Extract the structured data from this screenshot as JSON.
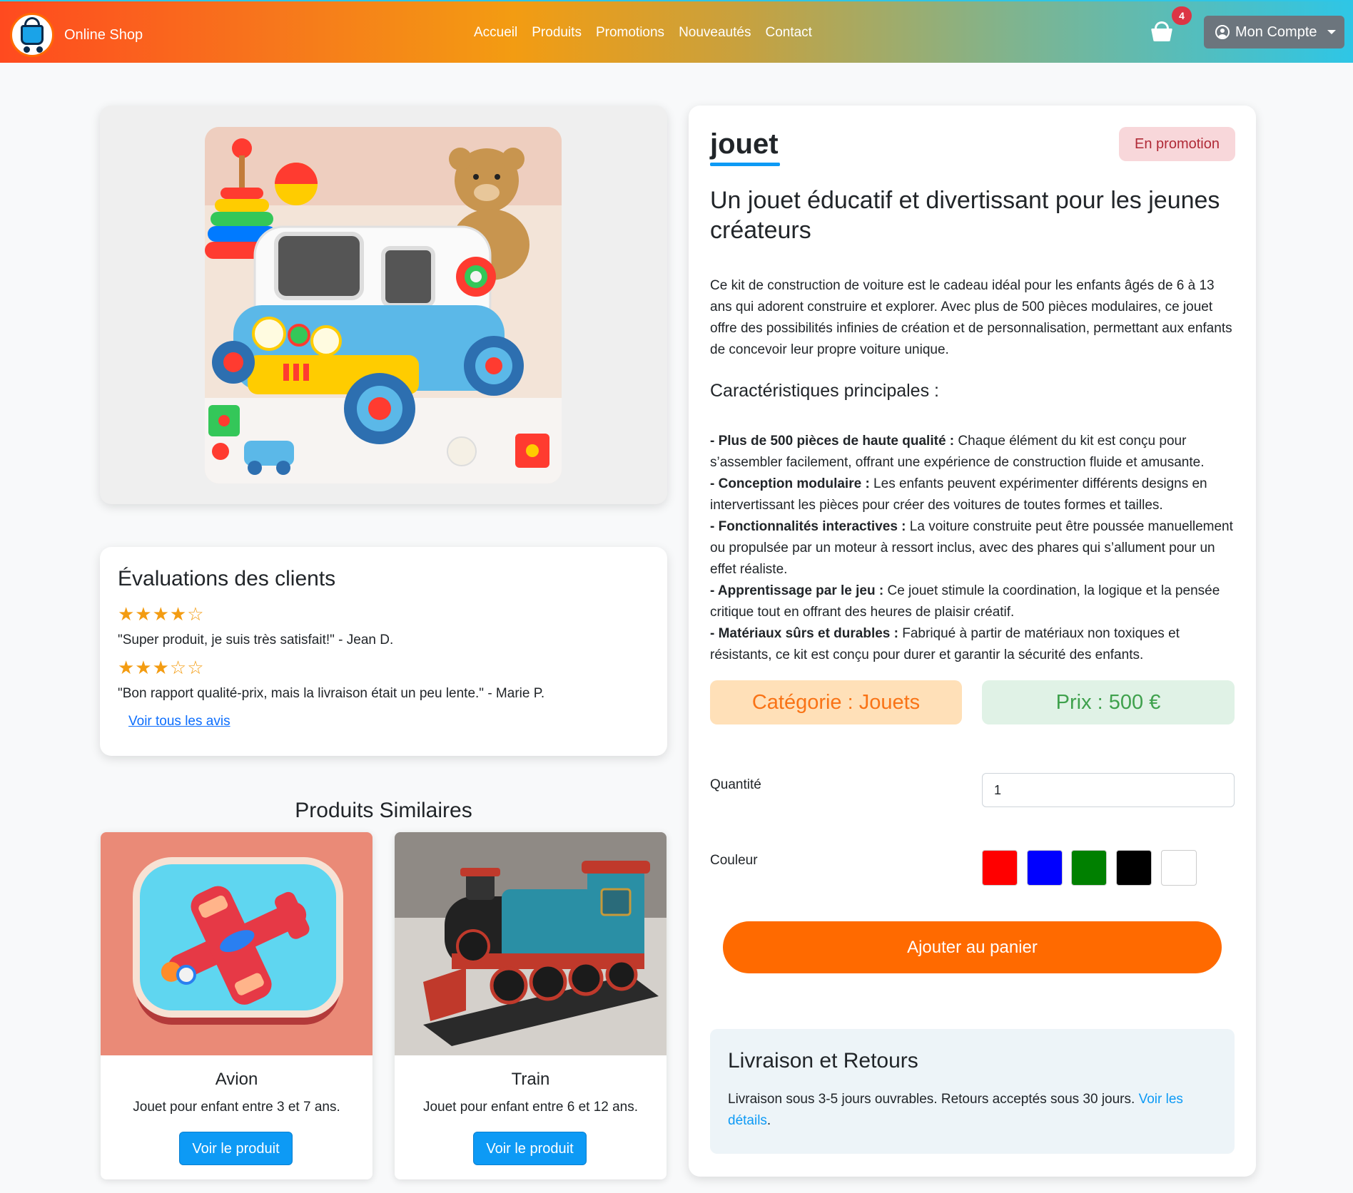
{
  "header": {
    "brand": "Online Shop",
    "nav": [
      "Accueil",
      "Produits",
      "Promotions",
      "Nouveautés",
      "Contact"
    ],
    "cart_count": "4",
    "account_label": "Mon Compte"
  },
  "product": {
    "name": "jouet",
    "badge": "En promotion",
    "headline": "Un jouet éducatif et divertissant pour les jeunes créateurs",
    "description": "Ce kit de construction de voiture est le cadeau idéal pour les enfants âgés de 6 à 13 ans qui adorent construire et explorer. Avec plus de 500 pièces modulaires, ce jouet offre des possibilités infinies de création et de personnalisation, permettant aux enfants de concevoir leur propre voiture unique.",
    "features_title": "Caractéristiques principales :",
    "features": [
      {
        "label": "- Plus de 500 pièces de haute qualité :",
        "text": " Chaque élément du kit est conçu pour s’assembler facilement, offrant une expérience de construction fluide et amusante."
      },
      {
        "label": "- Conception modulaire :",
        "text": " Les enfants peuvent expérimenter différents designs en intervertissant les pièces pour créer des voitures de toutes formes et tailles."
      },
      {
        "label": "- Fonctionnalités interactives :",
        "text": " La voiture construite peut être poussée manuellement ou propulsée par un moteur à ressort inclus, avec des phares qui s’allument pour un effet réaliste."
      },
      {
        "label": "- Apprentissage par le jeu :",
        "text": " Ce jouet stimule la coordination, la logique et la pensée critique tout en offrant des heures de plaisir créatif."
      },
      {
        "label": "- Matériaux sûrs et durables :",
        "text": " Fabriqué à partir de matériaux non toxiques et résistants, ce kit est conçu pour durer et garantir la sécurité des enfants."
      }
    ],
    "category": "Catégorie : Jouets",
    "price": "Prix : 500 €",
    "quantity_label": "Quantité",
    "quantity_value": "1",
    "color_label": "Couleur",
    "colors": [
      "#ff0000",
      "#0000ff",
      "#008000",
      "#000000",
      "#ffffff"
    ],
    "add_to_cart": "Ajouter au panier"
  },
  "reviews": {
    "title": "Évaluations des clients",
    "items": [
      {
        "stars": "★★★★☆",
        "rating": 4,
        "text": "\"Super produit, je suis très satisfait!\" - Jean D."
      },
      {
        "stars": "★★★☆☆",
        "rating": 3,
        "text": "\"Bon rapport qualité-prix, mais la livraison était un peu lente.\" - Marie P."
      }
    ],
    "link": "Voir tous les avis"
  },
  "similar": {
    "title": "Produits Similaires",
    "items": [
      {
        "name": "Avion",
        "desc": "Jouet pour enfant entre 3 et 7 ans.",
        "button": "Voir le produit"
      },
      {
        "name": "Train",
        "desc": "Jouet pour enfant entre 6 et 12 ans.",
        "button": "Voir le produit"
      }
    ]
  },
  "shipping": {
    "title": "Livraison et Retours",
    "text": "Livraison sous 3-5 jours ouvrables. Retours acceptés sous 30 jours. ",
    "link": "Voir les détails",
    "after": "."
  },
  "colors": {
    "accent_orange": "#ff6a00",
    "primary_blue": "#0d9af5",
    "star": "#f39c12"
  }
}
